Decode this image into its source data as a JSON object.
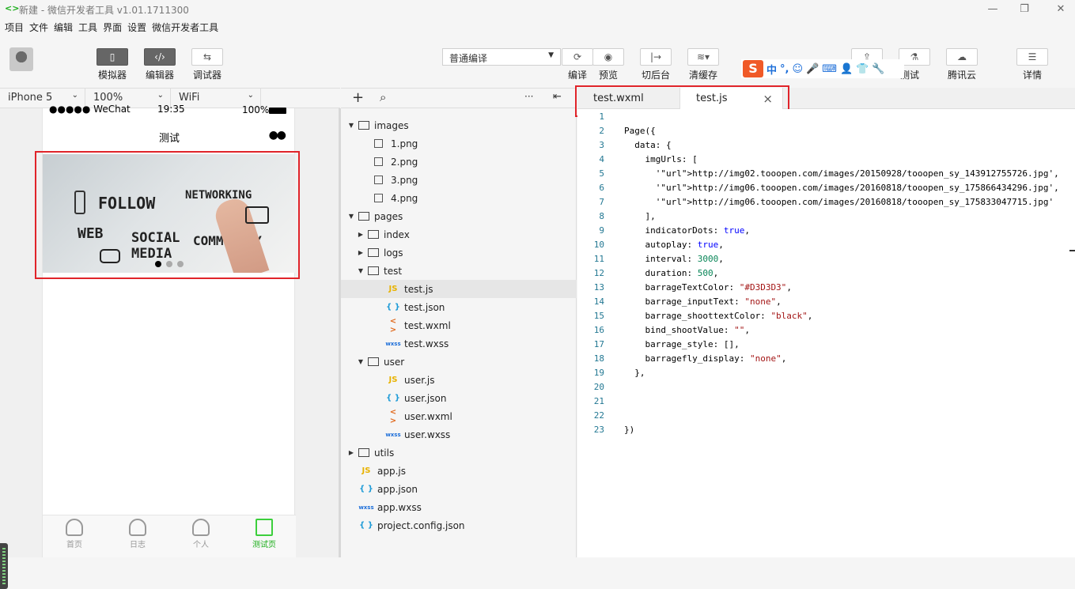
{
  "window": {
    "title": "新建 - 微信开发者工具 v1.01.1711300",
    "logo": "<>"
  },
  "menu": [
    "项目",
    "文件",
    "编辑",
    "工具",
    "界面",
    "设置",
    "微信开发者工具"
  ],
  "toolbar": {
    "simulator_label": "模拟器",
    "editor_label": "编辑器",
    "debugger_label": "调试器",
    "compile_mode": "普通编译",
    "compile_label": "编译",
    "preview_label": "预览",
    "background_label": "切后台",
    "clear_cache_label": "清缓存",
    "upload_label": "",
    "test_label": "测试",
    "tencent_cloud_label": "腾讯云",
    "details_label": "详情"
  },
  "ime": {
    "logo": "S",
    "items": [
      "中",
      "°,",
      "☺",
      "🎤",
      "⌨",
      "👤",
      "👕",
      "🔧"
    ]
  },
  "device": {
    "model": "iPhone 5",
    "zoom": "100%",
    "network": "WiFi"
  },
  "phone": {
    "carrier": "●●●●● WeChat",
    "time": "19:35",
    "battery": "100%",
    "nav_title": "测试",
    "nav_menu": "●●",
    "banner_words": [
      "FOLLOW",
      "NETWORKING",
      "WEB",
      "SOCIAL",
      "MEDIA",
      "COMMUNITY"
    ],
    "swiper_dots": 3,
    "swiper_active": 0,
    "tabs": [
      {
        "label": "首页",
        "active": false
      },
      {
        "label": "日志",
        "active": false
      },
      {
        "label": "个人",
        "active": false
      },
      {
        "label": "测试页",
        "active": true
      }
    ]
  },
  "filetree": {
    "toolbar": {
      "add": "+",
      "search": "⌕",
      "more": "···",
      "collapse": "⇤"
    },
    "nodes": [
      {
        "label": "images",
        "type": "folder",
        "depth": 0,
        "open": true
      },
      {
        "label": "1.png",
        "type": "img",
        "depth": 1
      },
      {
        "label": "2.png",
        "type": "img",
        "depth": 1
      },
      {
        "label": "3.png",
        "type": "img",
        "depth": 1
      },
      {
        "label": "4.png",
        "type": "img",
        "depth": 1
      },
      {
        "label": "pages",
        "type": "folder",
        "depth": 0,
        "open": true
      },
      {
        "label": "index",
        "type": "folder",
        "depth": 1,
        "open": false
      },
      {
        "label": "logs",
        "type": "folder",
        "depth": 1,
        "open": false
      },
      {
        "label": "test",
        "type": "folder",
        "depth": 1,
        "open": true
      },
      {
        "label": "test.js",
        "type": "js",
        "depth": 2,
        "selected": true
      },
      {
        "label": "test.json",
        "type": "json",
        "depth": 2
      },
      {
        "label": "test.wxml",
        "type": "wxml",
        "depth": 2
      },
      {
        "label": "test.wxss",
        "type": "wxss",
        "depth": 2
      },
      {
        "label": "user",
        "type": "folder",
        "depth": 1,
        "open": true
      },
      {
        "label": "user.js",
        "type": "js",
        "depth": 2
      },
      {
        "label": "user.json",
        "type": "json",
        "depth": 2
      },
      {
        "label": "user.wxml",
        "type": "wxml",
        "depth": 2
      },
      {
        "label": "user.wxss",
        "type": "wxss",
        "depth": 2
      },
      {
        "label": "utils",
        "type": "folder",
        "depth": 0,
        "open": false
      },
      {
        "label": "app.js",
        "type": "js",
        "depth": 0
      },
      {
        "label": "app.json",
        "type": "json",
        "depth": 0
      },
      {
        "label": "app.wxss",
        "type": "wxss",
        "depth": 0
      },
      {
        "label": "project.config.json",
        "type": "json",
        "depth": 0
      }
    ]
  },
  "editor": {
    "tabs": [
      {
        "label": "test.wxml",
        "active": false
      },
      {
        "label": "test.js",
        "active": true,
        "close": "×"
      }
    ],
    "lines": [
      "",
      "Page({",
      "  data: {",
      "    imgUrls: [",
      "      'http://img02.tooopen.com/images/20150928/tooopen_sy_143912755726.jpg',",
      "      'http://img06.tooopen.com/images/20160818/tooopen_sy_175866434296.jpg',",
      "      'http://img06.tooopen.com/images/20160818/tooopen_sy_175833047715.jpg'",
      "    ],",
      "    indicatorDots: true,",
      "    autoplay: true,",
      "    interval: 3000,",
      "    duration: 500,",
      "    barrageTextColor: \"#D3D3D3\",",
      "    barrage_inputText: \"none\",",
      "    barrage_shoottextColor: \"black\",",
      "    bind_shootValue: \"\",",
      "    barrage_style: [],",
      "    barragefly_display: \"none\",",
      "  },",
      "",
      "",
      "",
      "})"
    ]
  },
  "colors": {
    "highlight": "#e0242a",
    "accent": "#1aad19"
  }
}
